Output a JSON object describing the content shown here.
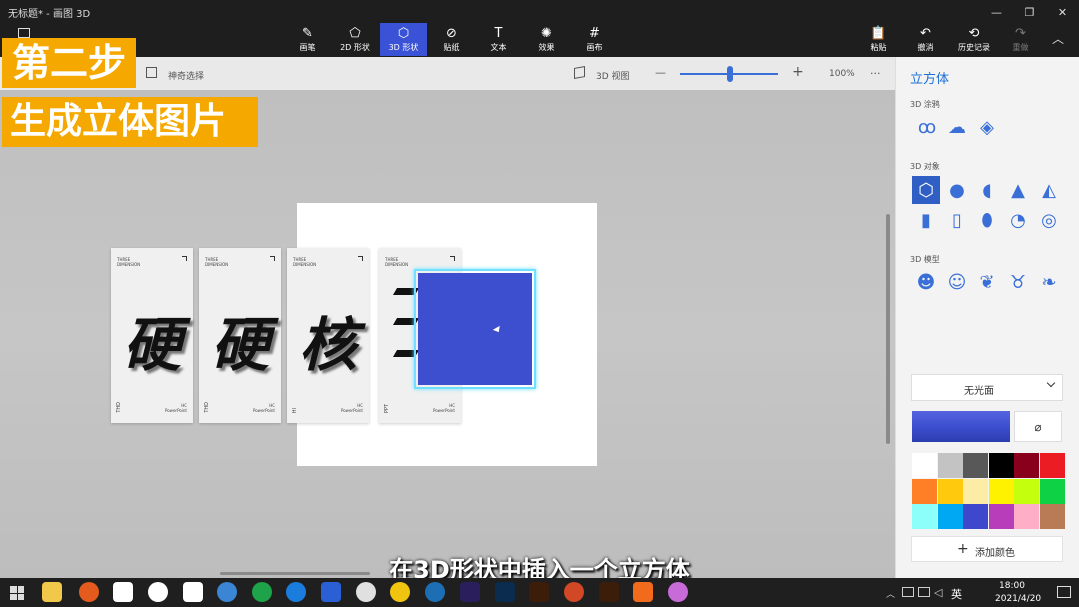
{
  "window": {
    "title": "无标题* - 画图 3D",
    "min": "—",
    "restore": "❐",
    "close": "✕"
  },
  "toolbar": {
    "tools": [
      {
        "label": "画笔",
        "icon": "✎"
      },
      {
        "label": "2D 形状",
        "icon": "⬠"
      },
      {
        "label": "3D 形状",
        "icon": "⬡"
      },
      {
        "label": "贴纸",
        "icon": "⊘"
      },
      {
        "label": "文本",
        "icon": "T"
      },
      {
        "label": "效果",
        "icon": "✺"
      },
      {
        "label": "画布",
        "icon": "#"
      }
    ],
    "right": [
      {
        "label": "粘贴",
        "icon": "📋"
      },
      {
        "label": "撤消",
        "icon": "↶"
      },
      {
        "label": "历史记录",
        "icon": "⟲"
      },
      {
        "label": "重做",
        "icon": "↷"
      }
    ],
    "collapse": "︿"
  },
  "subbar": {
    "magic_select": "神奇选择",
    "view3d": "3D 视图",
    "zoom_minus": "—",
    "zoom_plus": "+",
    "zoom": "100%",
    "more": "···"
  },
  "overlay": {
    "step": "第二步",
    "title": "生成立体图片",
    "caption": "在3D形状中插入一个立方体"
  },
  "cards": [
    {
      "top": "THREE\nDIMENSION",
      "big": "硬",
      "bl": "THD",
      "br": "HC\nPowerPoint"
    },
    {
      "top": "THREE\nDIMENSION",
      "big": "硬",
      "bl": "THD",
      "br": "HC\nPowerPoint"
    },
    {
      "top": "THREE\nDIMENSION",
      "big": "核",
      "bl": "HI",
      "br": "HC\nPowerPoint"
    },
    {
      "top": "THREE\nDIMENSION",
      "big": "",
      "bl": "PPT",
      "br": "HC\nPowerPoint"
    }
  ],
  "panel": {
    "title": "立方体",
    "doodle_label": "3D 涂鸦",
    "objects_label": "3D 对象",
    "models_label": "3D 模型",
    "material": "无光面",
    "add_color": "添加颜色",
    "doodle_icons": [
      "tube-doodle",
      "soft-doodle",
      "sharp-doodle"
    ],
    "object_icons": [
      "cube",
      "sphere",
      "hemisphere",
      "cone",
      "pyramid",
      "cylinder",
      "tube",
      "capsule",
      "donut-half",
      "torus"
    ],
    "model_icons": [
      "man",
      "woman",
      "dog",
      "cat",
      "fish"
    ],
    "selected_color": "#3d4fcf",
    "palette": [
      "#ffffff",
      "#c3c3c3",
      "#585858",
      "#000000",
      "#88001b",
      "#ec1c24",
      "#ff7f27",
      "#ffc90e",
      "#fdeca6",
      "#fff200",
      "#c4ff0e",
      "#0ed145",
      "#8cfffb",
      "#00a8f3",
      "#3f48cc",
      "#b83dba",
      "#ffaec8",
      "#b97a56"
    ]
  },
  "taskbar": {
    "time": "18:00",
    "date": "2021/4/20",
    "lang": "英"
  }
}
